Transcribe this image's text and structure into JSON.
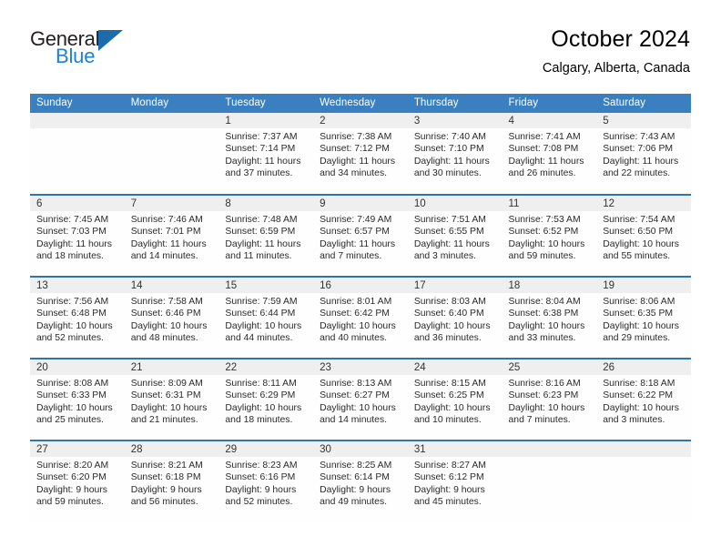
{
  "brand": {
    "word1": "General",
    "word2": "Blue",
    "triangle_color": "#1b6cab",
    "word1_color": "#231f20",
    "word2_color": "#1f81cf"
  },
  "header": {
    "title": "October 2024",
    "subtitle": "Calgary, Alberta, Canada"
  },
  "theme": {
    "header_row_bg": "#3a7fbf",
    "row_divider": "#2e75ae",
    "daynum_band_bg": "#efefef",
    "text_color": "#2a2a2a"
  },
  "labels": {
    "sunrise_prefix": "Sunrise:",
    "sunset_prefix": "Sunset:",
    "daylight_prefix": "Daylight:"
  },
  "weekday_headers": [
    "Sunday",
    "Monday",
    "Tuesday",
    "Wednesday",
    "Thursday",
    "Friday",
    "Saturday"
  ],
  "weeks": [
    [
      {
        "day": "",
        "empty": true,
        "sunrise": "",
        "sunset": "",
        "daylight_line1": "",
        "daylight_line2": ""
      },
      {
        "day": "",
        "empty": true,
        "sunrise": "",
        "sunset": "",
        "daylight_line1": "",
        "daylight_line2": ""
      },
      {
        "day": "1",
        "sunrise": "Sunrise: 7:37 AM",
        "sunset": "Sunset: 7:14 PM",
        "daylight_line1": "Daylight: 11 hours",
        "daylight_line2": "and 37 minutes."
      },
      {
        "day": "2",
        "sunrise": "Sunrise: 7:38 AM",
        "sunset": "Sunset: 7:12 PM",
        "daylight_line1": "Daylight: 11 hours",
        "daylight_line2": "and 34 minutes."
      },
      {
        "day": "3",
        "sunrise": "Sunrise: 7:40 AM",
        "sunset": "Sunset: 7:10 PM",
        "daylight_line1": "Daylight: 11 hours",
        "daylight_line2": "and 30 minutes."
      },
      {
        "day": "4",
        "sunrise": "Sunrise: 7:41 AM",
        "sunset": "Sunset: 7:08 PM",
        "daylight_line1": "Daylight: 11 hours",
        "daylight_line2": "and 26 minutes."
      },
      {
        "day": "5",
        "sunrise": "Sunrise: 7:43 AM",
        "sunset": "Sunset: 7:06 PM",
        "daylight_line1": "Daylight: 11 hours",
        "daylight_line2": "and 22 minutes."
      }
    ],
    [
      {
        "day": "6",
        "sunrise": "Sunrise: 7:45 AM",
        "sunset": "Sunset: 7:03 PM",
        "daylight_line1": "Daylight: 11 hours",
        "daylight_line2": "and 18 minutes."
      },
      {
        "day": "7",
        "sunrise": "Sunrise: 7:46 AM",
        "sunset": "Sunset: 7:01 PM",
        "daylight_line1": "Daylight: 11 hours",
        "daylight_line2": "and 14 minutes."
      },
      {
        "day": "8",
        "sunrise": "Sunrise: 7:48 AM",
        "sunset": "Sunset: 6:59 PM",
        "daylight_line1": "Daylight: 11 hours",
        "daylight_line2": "and 11 minutes."
      },
      {
        "day": "9",
        "sunrise": "Sunrise: 7:49 AM",
        "sunset": "Sunset: 6:57 PM",
        "daylight_line1": "Daylight: 11 hours",
        "daylight_line2": "and 7 minutes."
      },
      {
        "day": "10",
        "sunrise": "Sunrise: 7:51 AM",
        "sunset": "Sunset: 6:55 PM",
        "daylight_line1": "Daylight: 11 hours",
        "daylight_line2": "and 3 minutes."
      },
      {
        "day": "11",
        "sunrise": "Sunrise: 7:53 AM",
        "sunset": "Sunset: 6:52 PM",
        "daylight_line1": "Daylight: 10 hours",
        "daylight_line2": "and 59 minutes."
      },
      {
        "day": "12",
        "sunrise": "Sunrise: 7:54 AM",
        "sunset": "Sunset: 6:50 PM",
        "daylight_line1": "Daylight: 10 hours",
        "daylight_line2": "and 55 minutes."
      }
    ],
    [
      {
        "day": "13",
        "sunrise": "Sunrise: 7:56 AM",
        "sunset": "Sunset: 6:48 PM",
        "daylight_line1": "Daylight: 10 hours",
        "daylight_line2": "and 52 minutes."
      },
      {
        "day": "14",
        "sunrise": "Sunrise: 7:58 AM",
        "sunset": "Sunset: 6:46 PM",
        "daylight_line1": "Daylight: 10 hours",
        "daylight_line2": "and 48 minutes."
      },
      {
        "day": "15",
        "sunrise": "Sunrise: 7:59 AM",
        "sunset": "Sunset: 6:44 PM",
        "daylight_line1": "Daylight: 10 hours",
        "daylight_line2": "and 44 minutes."
      },
      {
        "day": "16",
        "sunrise": "Sunrise: 8:01 AM",
        "sunset": "Sunset: 6:42 PM",
        "daylight_line1": "Daylight: 10 hours",
        "daylight_line2": "and 40 minutes."
      },
      {
        "day": "17",
        "sunrise": "Sunrise: 8:03 AM",
        "sunset": "Sunset: 6:40 PM",
        "daylight_line1": "Daylight: 10 hours",
        "daylight_line2": "and 36 minutes."
      },
      {
        "day": "18",
        "sunrise": "Sunrise: 8:04 AM",
        "sunset": "Sunset: 6:38 PM",
        "daylight_line1": "Daylight: 10 hours",
        "daylight_line2": "and 33 minutes."
      },
      {
        "day": "19",
        "sunrise": "Sunrise: 8:06 AM",
        "sunset": "Sunset: 6:35 PM",
        "daylight_line1": "Daylight: 10 hours",
        "daylight_line2": "and 29 minutes."
      }
    ],
    [
      {
        "day": "20",
        "sunrise": "Sunrise: 8:08 AM",
        "sunset": "Sunset: 6:33 PM",
        "daylight_line1": "Daylight: 10 hours",
        "daylight_line2": "and 25 minutes."
      },
      {
        "day": "21",
        "sunrise": "Sunrise: 8:09 AM",
        "sunset": "Sunset: 6:31 PM",
        "daylight_line1": "Daylight: 10 hours",
        "daylight_line2": "and 21 minutes."
      },
      {
        "day": "22",
        "sunrise": "Sunrise: 8:11 AM",
        "sunset": "Sunset: 6:29 PM",
        "daylight_line1": "Daylight: 10 hours",
        "daylight_line2": "and 18 minutes."
      },
      {
        "day": "23",
        "sunrise": "Sunrise: 8:13 AM",
        "sunset": "Sunset: 6:27 PM",
        "daylight_line1": "Daylight: 10 hours",
        "daylight_line2": "and 14 minutes."
      },
      {
        "day": "24",
        "sunrise": "Sunrise: 8:15 AM",
        "sunset": "Sunset: 6:25 PM",
        "daylight_line1": "Daylight: 10 hours",
        "daylight_line2": "and 10 minutes."
      },
      {
        "day": "25",
        "sunrise": "Sunrise: 8:16 AM",
        "sunset": "Sunset: 6:23 PM",
        "daylight_line1": "Daylight: 10 hours",
        "daylight_line2": "and 7 minutes."
      },
      {
        "day": "26",
        "sunrise": "Sunrise: 8:18 AM",
        "sunset": "Sunset: 6:22 PM",
        "daylight_line1": "Daylight: 10 hours",
        "daylight_line2": "and 3 minutes."
      }
    ],
    [
      {
        "day": "27",
        "sunrise": "Sunrise: 8:20 AM",
        "sunset": "Sunset: 6:20 PM",
        "daylight_line1": "Daylight: 9 hours",
        "daylight_line2": "and 59 minutes."
      },
      {
        "day": "28",
        "sunrise": "Sunrise: 8:21 AM",
        "sunset": "Sunset: 6:18 PM",
        "daylight_line1": "Daylight: 9 hours",
        "daylight_line2": "and 56 minutes."
      },
      {
        "day": "29",
        "sunrise": "Sunrise: 8:23 AM",
        "sunset": "Sunset: 6:16 PM",
        "daylight_line1": "Daylight: 9 hours",
        "daylight_line2": "and 52 minutes."
      },
      {
        "day": "30",
        "sunrise": "Sunrise: 8:25 AM",
        "sunset": "Sunset: 6:14 PM",
        "daylight_line1": "Daylight: 9 hours",
        "daylight_line2": "and 49 minutes."
      },
      {
        "day": "31",
        "sunrise": "Sunrise: 8:27 AM",
        "sunset": "Sunset: 6:12 PM",
        "daylight_line1": "Daylight: 9 hours",
        "daylight_line2": "and 45 minutes."
      },
      {
        "day": "",
        "empty": true,
        "sunrise": "",
        "sunset": "",
        "daylight_line1": "",
        "daylight_line2": ""
      },
      {
        "day": "",
        "empty": true,
        "sunrise": "",
        "sunset": "",
        "daylight_line1": "",
        "daylight_line2": ""
      }
    ]
  ]
}
